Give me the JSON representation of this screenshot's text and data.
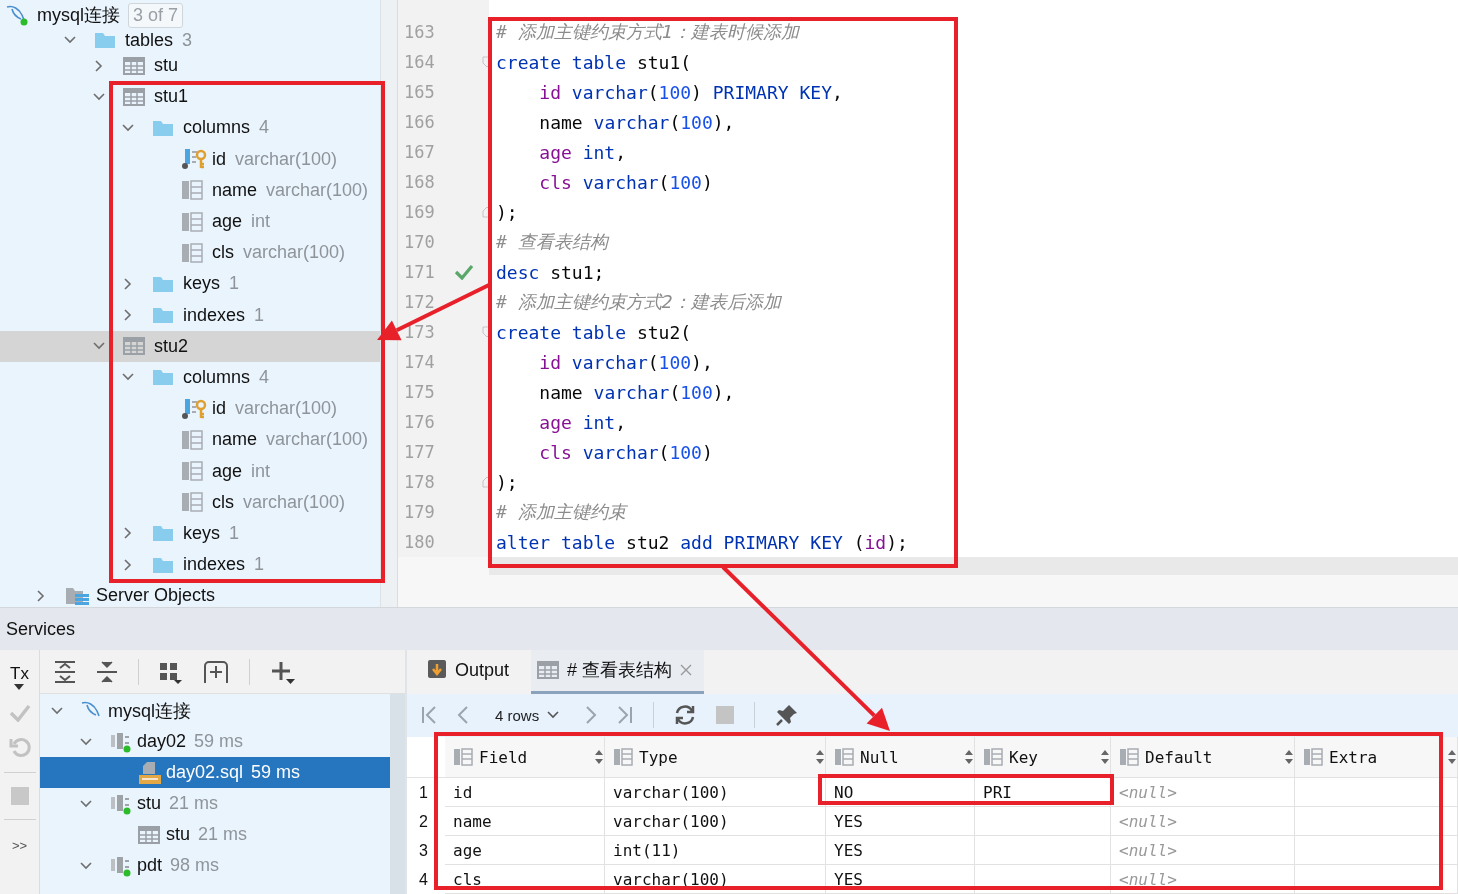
{
  "explorer": {
    "connection": {
      "name": "mysql连接",
      "badge": "3 of 7"
    },
    "branch": {
      "kind": "folder",
      "label": "tables",
      "count": "3",
      "expanded": true,
      "selected": false,
      "children": [
        {
          "kind": "table",
          "label": "stu",
          "expanded": false,
          "selected": false
        },
        {
          "kind": "table",
          "label": "stu1",
          "expanded": true,
          "selected": false,
          "children": [
            {
              "kind": "folder",
              "label": "columns",
              "count": "4",
              "expanded": true,
              "selected": false,
              "children": [
                {
                  "kind": "key-column",
                  "label": "id",
                  "type": "varchar(100)",
                  "selected": false
                },
                {
                  "kind": "column",
                  "label": "name",
                  "type": "varchar(100)",
                  "selected": false
                },
                {
                  "kind": "column",
                  "label": "age",
                  "type": "int",
                  "selected": false
                },
                {
                  "kind": "column",
                  "label": "cls",
                  "type": "varchar(100)",
                  "selected": false
                }
              ]
            },
            {
              "kind": "folder",
              "label": "keys",
              "count": "1",
              "expanded": false,
              "selected": false
            },
            {
              "kind": "folder",
              "label": "indexes",
              "count": "1",
              "expanded": false,
              "selected": false
            }
          ]
        },
        {
          "kind": "table",
          "label": "stu2",
          "expanded": true,
          "selected": true,
          "children": [
            {
              "kind": "folder",
              "label": "columns",
              "count": "4",
              "expanded": true,
              "selected": false,
              "children": [
                {
                  "kind": "key-column",
                  "label": "id",
                  "type": "varchar(100)",
                  "selected": false
                },
                {
                  "kind": "column",
                  "label": "name",
                  "type": "varchar(100)",
                  "selected": false
                },
                {
                  "kind": "column",
                  "label": "age",
                  "type": "int",
                  "selected": false
                },
                {
                  "kind": "column",
                  "label": "cls",
                  "type": "varchar(100)",
                  "selected": false
                }
              ]
            },
            {
              "kind": "folder",
              "label": "keys",
              "count": "1",
              "expanded": false,
              "selected": false
            },
            {
              "kind": "folder",
              "label": "indexes",
              "count": "1",
              "expanded": false,
              "selected": false
            }
          ]
        }
      ]
    },
    "tree": [
      {
        "kind": "server-objects",
        "label": "Server Objects",
        "expanded": false,
        "selected": false
      }
    ]
  },
  "editor": {
    "lines": [
      {
        "number": "163",
        "kind": "code",
        "executed": false,
        "tokens": [
          {
            "kind": "comment",
            "text": "# 添加主键约束方式1：建表时候添加"
          }
        ]
      },
      {
        "number": "164",
        "kind": "fold-start",
        "executed": false,
        "tokens": [
          {
            "kind": "keyword",
            "text": "create table"
          },
          {
            "kind": "plain",
            "text": " stu1("
          }
        ]
      },
      {
        "number": "165",
        "kind": "code",
        "executed": false,
        "tokens": [
          {
            "kind": "column",
            "text": "    id"
          },
          {
            "kind": "keyword",
            "text": " varchar"
          },
          {
            "kind": "plain",
            "text": "("
          },
          {
            "kind": "number",
            "text": "100"
          },
          {
            "kind": "plain",
            "text": ")"
          },
          {
            "kind": "keyword",
            "text": " PRIMARY KEY"
          },
          {
            "kind": "plain",
            "text": ","
          }
        ]
      },
      {
        "number": "166",
        "kind": "code",
        "executed": false,
        "tokens": [
          {
            "kind": "plain",
            "text": "    name "
          },
          {
            "kind": "keyword",
            "text": "varchar"
          },
          {
            "kind": "plain",
            "text": "("
          },
          {
            "kind": "number",
            "text": "100"
          },
          {
            "kind": "plain",
            "text": "),"
          }
        ]
      },
      {
        "number": "167",
        "kind": "code",
        "executed": false,
        "tokens": [
          {
            "kind": "column",
            "text": "    age"
          },
          {
            "kind": "keyword",
            "text": " int"
          },
          {
            "kind": "plain",
            "text": ","
          }
        ]
      },
      {
        "number": "168",
        "kind": "code",
        "executed": false,
        "tokens": [
          {
            "kind": "column",
            "text": "    cls"
          },
          {
            "kind": "keyword",
            "text": " varchar"
          },
          {
            "kind": "plain",
            "text": "("
          },
          {
            "kind": "number",
            "text": "100"
          },
          {
            "kind": "plain",
            "text": ")"
          }
        ]
      },
      {
        "number": "169",
        "kind": "fold-end",
        "executed": false,
        "tokens": [
          {
            "kind": "plain",
            "text": ");"
          }
        ]
      },
      {
        "number": "170",
        "kind": "code",
        "executed": false,
        "tokens": [
          {
            "kind": "comment",
            "text": "# 查看表结构"
          }
        ]
      },
      {
        "number": "171",
        "kind": "code",
        "executed": true,
        "tokens": [
          {
            "kind": "keyword",
            "text": "desc"
          },
          {
            "kind": "plain",
            "text": " stu1;"
          }
        ]
      },
      {
        "number": "172",
        "kind": "code",
        "executed": false,
        "tokens": [
          {
            "kind": "comment",
            "text": "# 添加主键约束方式2：建表后添加"
          }
        ]
      },
      {
        "number": "173",
        "kind": "fold-start",
        "executed": false,
        "tokens": [
          {
            "kind": "keyword",
            "text": "create table"
          },
          {
            "kind": "plain",
            "text": " stu2("
          }
        ]
      },
      {
        "number": "174",
        "kind": "code",
        "executed": false,
        "tokens": [
          {
            "kind": "column",
            "text": "    id"
          },
          {
            "kind": "keyword",
            "text": " varchar"
          },
          {
            "kind": "plain",
            "text": "("
          },
          {
            "kind": "number",
            "text": "100"
          },
          {
            "kind": "plain",
            "text": "),"
          }
        ]
      },
      {
        "number": "175",
        "kind": "code",
        "executed": false,
        "tokens": [
          {
            "kind": "plain",
            "text": "    name "
          },
          {
            "kind": "keyword",
            "text": "varchar"
          },
          {
            "kind": "plain",
            "text": "("
          },
          {
            "kind": "number",
            "text": "100"
          },
          {
            "kind": "plain",
            "text": "),"
          }
        ]
      },
      {
        "number": "176",
        "kind": "code",
        "executed": false,
        "tokens": [
          {
            "kind": "column",
            "text": "    age"
          },
          {
            "kind": "keyword",
            "text": " int"
          },
          {
            "kind": "plain",
            "text": ","
          }
        ]
      },
      {
        "number": "177",
        "kind": "code",
        "executed": false,
        "tokens": [
          {
            "kind": "column",
            "text": "    cls"
          },
          {
            "kind": "keyword",
            "text": " varchar"
          },
          {
            "kind": "plain",
            "text": "("
          },
          {
            "kind": "number",
            "text": "100"
          },
          {
            "kind": "plain",
            "text": ")"
          }
        ]
      },
      {
        "number": "178",
        "kind": "fold-end",
        "executed": false,
        "tokens": [
          {
            "kind": "plain",
            "text": ");"
          }
        ]
      },
      {
        "number": "179",
        "kind": "code",
        "executed": false,
        "tokens": [
          {
            "kind": "comment",
            "text": "# 添加主键约束"
          }
        ]
      },
      {
        "number": "180",
        "kind": "code",
        "executed": false,
        "tokens": [
          {
            "kind": "keyword",
            "text": "alter table"
          },
          {
            "kind": "plain",
            "text": " stu2 "
          },
          {
            "kind": "keyword",
            "text": "add PRIMARY KEY"
          },
          {
            "kind": "plain",
            "text": " ("
          },
          {
            "kind": "column",
            "text": "id"
          },
          {
            "kind": "plain",
            "text": ");"
          }
        ]
      }
    ]
  },
  "services": {
    "title": "Services",
    "tx_label": "Tx",
    "more_label": ">>",
    "tree": [
      {
        "kind": "connection",
        "label": "mysql连接",
        "expanded": true,
        "selected": false,
        "children": [
          {
            "kind": "session",
            "label": "day02",
            "time": "59 ms",
            "expanded": true,
            "selected": false,
            "children": [
              {
                "kind": "sql-file",
                "label": "day02.sql",
                "time": "59 ms",
                "selected": true
              }
            ]
          },
          {
            "kind": "session",
            "label": "stu",
            "time": "21 ms",
            "expanded": true,
            "selected": false,
            "children": [
              {
                "kind": "table",
                "label": "stu",
                "time": "21 ms",
                "selected": false
              }
            ]
          },
          {
            "kind": "session",
            "label": "pdt",
            "time": "98 ms",
            "expanded": true,
            "selected": false
          }
        ]
      }
    ]
  },
  "results": {
    "tabs": [
      {
        "kind": "output",
        "label": "Output",
        "selected": false,
        "closable": false
      },
      {
        "kind": "result",
        "label": "# 查看表结构",
        "selected": true,
        "closable": true
      }
    ],
    "row_count": "4 rows",
    "columns": [
      "Field",
      "Type",
      "Null",
      "Key",
      "Default",
      "Extra"
    ],
    "rows": [
      {
        "number": "1",
        "cells": [
          {
            "kind": "value",
            "text": "id"
          },
          {
            "kind": "value",
            "text": "varchar(100)"
          },
          {
            "kind": "value",
            "text": "NO"
          },
          {
            "kind": "value",
            "text": "PRI"
          },
          {
            "kind": "null",
            "text": "<null>"
          },
          {
            "kind": "empty"
          }
        ]
      },
      {
        "number": "2",
        "cells": [
          {
            "kind": "value",
            "text": "name"
          },
          {
            "kind": "value",
            "text": "varchar(100)"
          },
          {
            "kind": "value",
            "text": "YES"
          },
          {
            "kind": "empty"
          },
          {
            "kind": "null",
            "text": "<null>"
          },
          {
            "kind": "empty"
          }
        ]
      },
      {
        "number": "3",
        "cells": [
          {
            "kind": "value",
            "text": "age"
          },
          {
            "kind": "value",
            "text": "int(11)"
          },
          {
            "kind": "value",
            "text": "YES"
          },
          {
            "kind": "empty"
          },
          {
            "kind": "null",
            "text": "<null>"
          },
          {
            "kind": "empty"
          }
        ]
      },
      {
        "number": "4",
        "cells": [
          {
            "kind": "value",
            "text": "cls"
          },
          {
            "kind": "value",
            "text": "varchar(100)"
          },
          {
            "kind": "value",
            "text": "YES"
          },
          {
            "kind": "empty"
          },
          {
            "kind": "null",
            "text": "<null>"
          },
          {
            "kind": "empty"
          }
        ]
      }
    ]
  }
}
